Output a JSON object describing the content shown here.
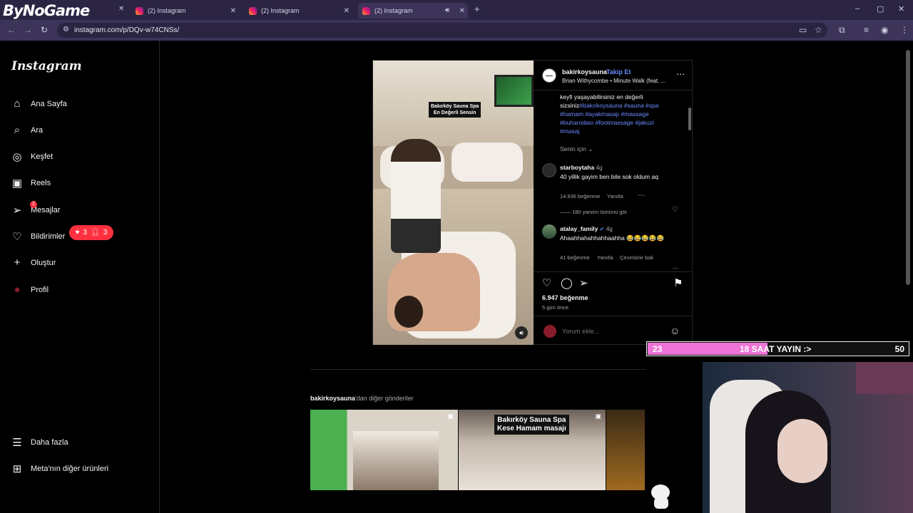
{
  "browser": {
    "brand_overlay": "ByNoGame",
    "tabs": [
      {
        "label": "(2) Instagram"
      },
      {
        "label": "(2) Instagram"
      },
      {
        "label": "(2) Instagram",
        "active": true
      }
    ],
    "new_tab_label": "+",
    "url": "instagram.com/p/DQv-w74CNSs/",
    "window_controls": [
      "–",
      "▢",
      "✕"
    ]
  },
  "sidebar": {
    "logo": "Instagram",
    "items": [
      {
        "label": "Ana Sayfa",
        "icon": "home-icon",
        "glyph": "⌂"
      },
      {
        "label": "Ara",
        "icon": "search-icon",
        "glyph": "⌕"
      },
      {
        "label": "Keşfet",
        "icon": "explore-compass-icon",
        "glyph": "◎"
      },
      {
        "label": "Reels",
        "icon": "reels-icon",
        "glyph": "▣"
      },
      {
        "label": "Mesajlar",
        "icon": "messenger-icon",
        "glyph": "➢",
        "badge": "2"
      },
      {
        "label": "Bildirimler",
        "icon": "heart-icon",
        "glyph": "♡"
      },
      {
        "label": "Oluştur",
        "icon": "plus-icon",
        "glyph": "+"
      },
      {
        "label": "Profil",
        "icon": "profile-avatar-icon",
        "glyph": "●"
      }
    ],
    "notification_pill": {
      "likes": "3",
      "follows": "3"
    },
    "footer": [
      {
        "label": "Daha fazla",
        "icon": "menu-icon",
        "glyph": "☰"
      },
      {
        "label": "Meta'nın diğer ürünleri",
        "icon": "apps-icon",
        "glyph": "⊞"
      }
    ]
  },
  "post": {
    "username": "bakirkoysauna",
    "follow": "Takip Et",
    "audio": "Brian Withycombe • Minute Walk (feat. ...",
    "video_caption": "Bakırköy Sauna Spa\nEn Değerli Sensin",
    "caption_text": "keyfi yaşayabilirsiniz en değerli sizsiniz",
    "caption_tags": "#bakırkoysauna #sauna #spa #hamam #ayakmasajı #massage #buharodası #footmassage #jakuzi #masaj",
    "for_you": "Senin için",
    "comments": [
      {
        "user": "starboytaha",
        "time": "4g",
        "text": "40 yillik gayim ben bile sok oldum aq",
        "likes": "14.936 beğenme",
        "reply": "Yanıtla",
        "view_replies": "180 yanıtın tümünü gör"
      },
      {
        "user": "atalay_family",
        "time": "4g",
        "verified": true,
        "text": "Ahaahhahahhahhaahha 😂😂😂😂😂",
        "likes": "41 beğenme",
        "reply": "Yanıtla",
        "translate": "Çevirisine bak"
      }
    ],
    "like_count": "6.947 beğenme",
    "posted_ago": "5 gün önce",
    "add_comment_placeholder": "Yorum ekle..."
  },
  "more_posts": {
    "title_user": "bakirkoysauna",
    "title_suffix": "'dan diğer gönderiler",
    "thumbs": [
      {
        "label": ""
      },
      {
        "label": "Bakırköy Sauna Spa\nKese Hamam masajı"
      },
      {
        "label": ""
      }
    ]
  },
  "stream_overlay": {
    "left_value": "23",
    "title": "18 SAAT YAYIN :>",
    "right_value": "50",
    "progress": 0.46
  },
  "colors": {
    "accent_blue": "#6a8cff",
    "notification_red": "#ff3040",
    "stream_pink": "#ee73d6"
  }
}
